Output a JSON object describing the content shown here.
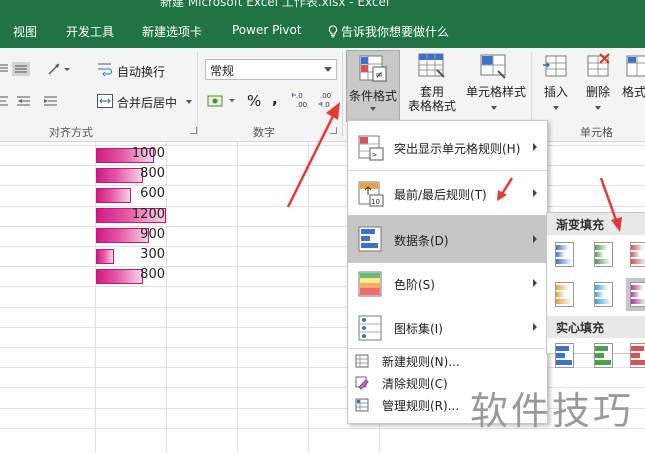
{
  "window": {
    "title": "新建 Microsoft Excel 工作表.xlsx  -  Excel"
  },
  "tabs": [
    "视图",
    "开发工具",
    "新建选项卡",
    "Power Pivot"
  ],
  "tell_me": "告诉我你想要做什么",
  "ribbon": {
    "alignment": {
      "wrap_text": "自动换行",
      "merge_center": "合并后居中",
      "group_label": "对齐方式"
    },
    "number": {
      "format_value": "常规",
      "percent": "%",
      "comma": ",",
      "inc_decimal": "←.0\n.00",
      "dec_decimal": ".00\n→.0",
      "group_label": "数字"
    },
    "styles": {
      "conditional_format": "条件格式",
      "table_format_1": "套用",
      "table_format_2": "表格格式",
      "cell_styles": "单元格样式"
    },
    "cells": {
      "insert": "插入",
      "delete": "删除",
      "format": "格式",
      "group_label": "单元格"
    }
  },
  "sheet": {
    "values": [
      "1000",
      "800",
      "600",
      "1200",
      "900",
      "300",
      "800"
    ],
    "fractions": [
      0.833,
      0.667,
      0.5,
      1.0,
      0.75,
      0.25,
      0.667
    ]
  },
  "menu": {
    "items": [
      {
        "label": "突出显示单元格规则(H)",
        "icon": "highlight-rules-icon"
      },
      {
        "label": "最前/最后规则(T)",
        "icon": "top-bottom-rules-icon"
      },
      {
        "label": "数据条(D)",
        "icon": "data-bars-icon"
      },
      {
        "label": "色阶(S)",
        "icon": "color-scales-icon"
      },
      {
        "label": "图标集(I)",
        "icon": "icon-sets-icon"
      }
    ],
    "small_items": [
      {
        "label": "新建规则(N)...",
        "icon": "new-rule-icon"
      },
      {
        "label": "清除规则(C)",
        "icon": "clear-rules-icon"
      },
      {
        "label": "管理规则(R)...",
        "icon": "manage-rules-icon"
      }
    ]
  },
  "submenu": {
    "gradient_fill": "渐变填充",
    "solid_fill": "实心填充"
  },
  "colors": {
    "ribbon_green": "#217346",
    "data_bar": "#d01a83",
    "annotation_red": "#e53935"
  },
  "watermark": "软件技巧"
}
